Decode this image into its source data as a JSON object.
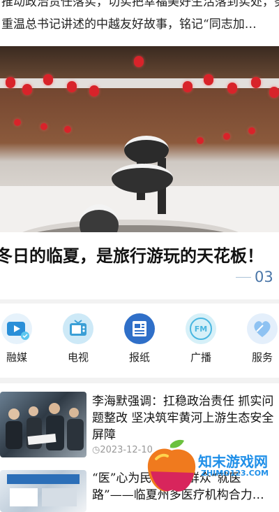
{
  "top": {
    "line1": "推动政治责任落实，切实把幸福美好生活落到实处，努力推动城市高质量发展",
    "line2": "重温总书记讲述的中越友好故事，铭记“同志加…"
  },
  "carousel": {
    "headline": "冬日的临夏，是旅行游玩的天花板！",
    "page": "03"
  },
  "nav": [
    {
      "label": "融媒",
      "icon": "video-media-icon",
      "color": "#2a8fd8"
    },
    {
      "label": "电视",
      "icon": "tv-icon",
      "color": "#3a9fd6"
    },
    {
      "label": "报纸",
      "icon": "newspaper-icon",
      "color": "#2f6fc8"
    },
    {
      "label": "广播",
      "icon": "fm-radio-icon",
      "color": "#49b6e0"
    },
    {
      "label": "服务",
      "icon": "service-icon",
      "color": "#5aa2e6"
    }
  ],
  "news": [
    {
      "title": "李海默强调：扛稳政治责任 抓实问题整改 坚决筑牢黄河上游生态安全屏障",
      "time": "2023-12-10"
    },
    {
      "title": "“医”心为民“点亮”群众“就医路”——临夏州多医疗机构合力…",
      "time": ""
    }
  ],
  "watermark": {
    "text": "知末游戏网",
    "url": "ZHIMO123.COM"
  }
}
